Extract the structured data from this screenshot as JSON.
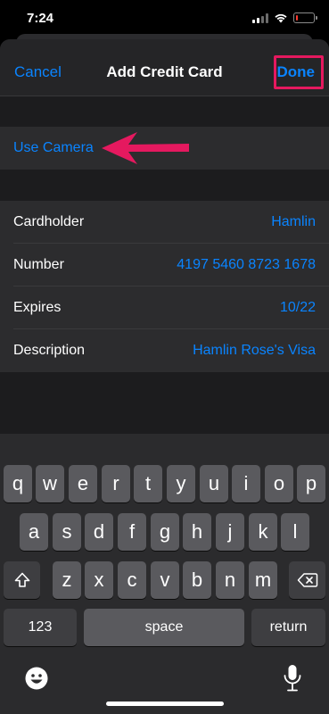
{
  "status_bar": {
    "time": "7:24",
    "battery_level_fraction": 0.1,
    "battery_color": "#ff3b30",
    "icons": [
      "cellular-signal-icon",
      "wifi-icon",
      "battery-icon"
    ]
  },
  "nav": {
    "cancel_label": "Cancel",
    "title": "Add Credit Card",
    "done_label": "Done",
    "accent_color": "#0a84ff",
    "highlight_color": "#e5195f"
  },
  "camera": {
    "label": "Use Camera",
    "arrow_icon": "arrow-left-icon"
  },
  "card_fields": [
    {
      "label": "Cardholder",
      "value": "Hamlin"
    },
    {
      "label": "Number",
      "value": "4197 5460 8723 1678"
    },
    {
      "label": "Expires",
      "value": "10/22"
    },
    {
      "label": "Description",
      "value": "Hamlin Rose's Visa"
    }
  ],
  "keyboard": {
    "row1": [
      "q",
      "w",
      "e",
      "r",
      "t",
      "y",
      "u",
      "i",
      "o",
      "p"
    ],
    "row2": [
      "a",
      "s",
      "d",
      "f",
      "g",
      "h",
      "j",
      "k",
      "l"
    ],
    "row3": [
      "z",
      "x",
      "c",
      "v",
      "b",
      "n",
      "m"
    ],
    "numbers_label": "123",
    "space_label": "space",
    "return_label": "return",
    "shift_icon": "shift-icon",
    "delete_icon": "delete-icon",
    "emoji_icon": "emoji-icon",
    "mic_icon": "microphone-icon"
  }
}
